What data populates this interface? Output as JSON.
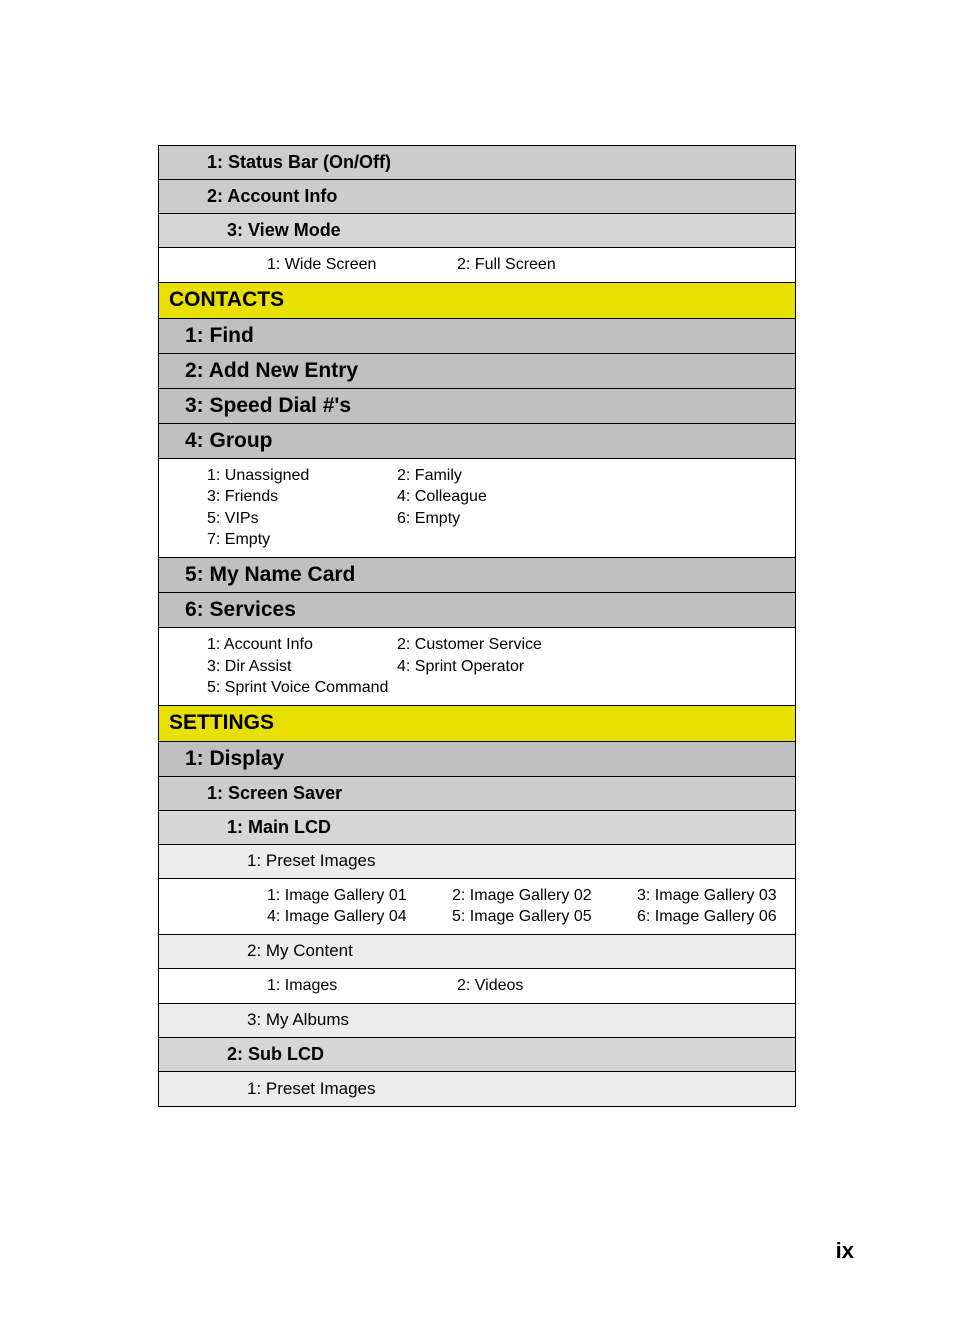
{
  "page_number": "ix",
  "rows": {
    "status_bar": "1: Status Bar (On/Off)",
    "account_info": "2: Account Info",
    "view_mode": "3: View Mode",
    "view_mode_items": {
      "c1": [
        "1: Wide Screen"
      ],
      "c2": [
        "2: Full Screen"
      ]
    },
    "contacts": "CONTACTS",
    "find": "1: Find",
    "add_new": "2: Add New Entry",
    "speed_dial": "3: Speed Dial #'s",
    "group": "4: Group",
    "group_items": {
      "c1": [
        "1: Unassigned",
        "3: Friends",
        "5: VIPs",
        "7: Empty"
      ],
      "c2": [
        "2: Family",
        "4: Colleague",
        "6: Empty"
      ]
    },
    "name_card": "5: My Name Card",
    "services": "6: Services",
    "services_items": {
      "c1": [
        "1: Account Info",
        "3: Dir Assist",
        "5: Sprint Voice Command"
      ],
      "c2": [
        "2: Customer Service",
        "4: Sprint Operator"
      ]
    },
    "settings": "SETTINGS",
    "display": "1: Display",
    "screen_saver": "1: Screen Saver",
    "main_lcd": "1: Main LCD",
    "preset_images": "1: Preset Images",
    "gallery_items": {
      "c1": [
        "1: Image Gallery 01",
        "4: Image Gallery 04"
      ],
      "c2": [
        "2: Image Gallery 02",
        "5: Image Gallery 05"
      ],
      "c3": [
        "3: Image Gallery 03",
        "6: Image Gallery 06"
      ]
    },
    "my_content": "2: My Content",
    "my_content_items": {
      "c1": [
        "1: Images"
      ],
      "c2": [
        "2: Videos"
      ]
    },
    "my_albums": "3: My Albums",
    "sub_lcd": "2: Sub LCD",
    "preset_images_2": "1: Preset Images"
  }
}
